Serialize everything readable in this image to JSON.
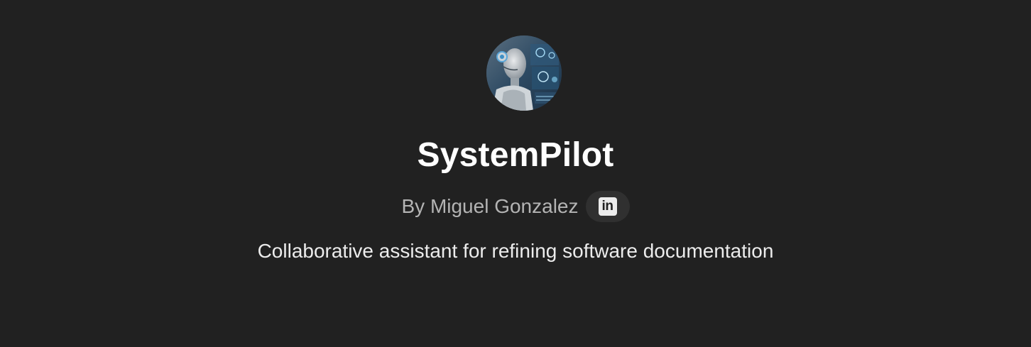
{
  "gpt": {
    "name": "SystemPilot",
    "author_line": "By Miguel Gonzalez",
    "description": "Collaborative assistant for refining software documentation",
    "avatar_alt": "SystemPilot",
    "social": {
      "icon": "linkedin-icon",
      "glyph": "in"
    }
  },
  "colors": {
    "background": "#212121",
    "title": "#ffffff",
    "author": "#b4b4b4",
    "description": "#ececec",
    "social_button_bg": "#303030"
  }
}
